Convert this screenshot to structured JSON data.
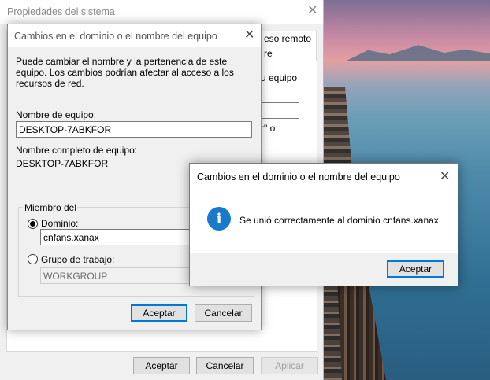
{
  "background_window": {
    "title": "Propiedades del sistema",
    "tab_fragment_1": "eso remoto",
    "tab_fragment_2": "re",
    "text_fragment_1": "u equipo",
    "text_fragment_2": "r\" o",
    "buttons": {
      "ok": "Aceptar",
      "cancel": "Cancelar",
      "apply": "Aplicar"
    }
  },
  "domain_dialog": {
    "title": "Cambios en el dominio o el nombre del equipo",
    "description": "Puede cambiar el nombre y la pertenencia de este equipo. Los cambios podrían afectar al acceso a los recursos de red.",
    "computer_name_label": "Nombre de equipo:",
    "computer_name_value": "DESKTOP-7ABKFOR",
    "full_name_label": "Nombre completo de equipo:",
    "full_name_value": "DESKTOP-7ABKFOR",
    "member_group_label": "Miembro del",
    "domain_radio_label": "Dominio:",
    "domain_value": "cnfans.xanax",
    "workgroup_radio_label": "Grupo de trabajo:",
    "workgroup_value": "WORKGROUP",
    "selected_membership": "Dominio",
    "buttons": {
      "ok": "Aceptar",
      "cancel": "Cancelar"
    }
  },
  "message_box": {
    "title": "Cambios en el dominio o el nombre del equipo",
    "icon": "info-icon",
    "message": "Se unió correctamente al dominio cnfans.xanax.",
    "ok_button": "Aceptar"
  },
  "colors": {
    "accent": "#0078d7",
    "info_icon": "#1979ca"
  }
}
